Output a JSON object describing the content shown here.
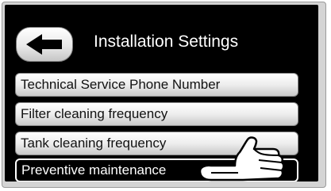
{
  "header": {
    "title": "Installation Settings",
    "back_icon": "arrow-left-icon"
  },
  "menu": {
    "items": [
      {
        "label": "Technical Service Phone Number",
        "selected": false
      },
      {
        "label": "Filter cleaning frequency",
        "selected": false
      },
      {
        "label": "Tank cleaning frequency",
        "selected": false
      },
      {
        "label": "Preventive maintenance",
        "selected": true
      }
    ]
  },
  "overlay": {
    "pointer_icon": "pointing-hand-icon"
  },
  "colors": {
    "screen_background": "#000000",
    "button_face": "#ececec",
    "text_on_dark": "#ffffff",
    "text_on_light": "#111111"
  }
}
